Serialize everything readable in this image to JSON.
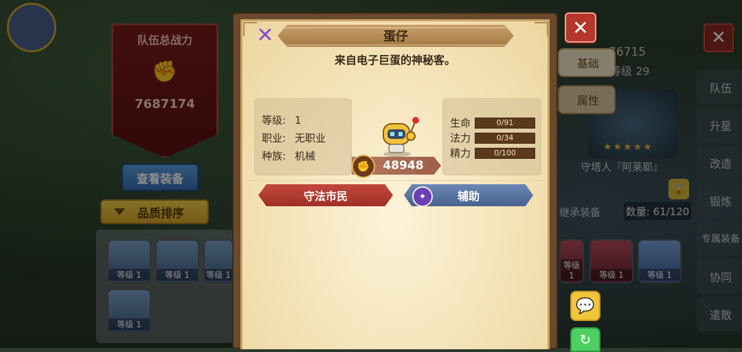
{
  "background": {
    "team_power_title": "队伍总战力",
    "team_power_value": "7687174",
    "view_equipment_button": "查看装备",
    "quality_sort_button": "品质排序",
    "hero_level_labels": [
      "等级 1",
      "等级 1",
      "等级 1",
      "等级 1"
    ],
    "right_hero_level_labels": [
      "等级 1",
      "等级 1",
      "等级 1"
    ],
    "right_top_number": "76715",
    "right_top_level": "等级 29",
    "tab_basic": "基础",
    "tab_attributes": "属性",
    "hero_subname": "守塔人『阿莱耶』",
    "inherit_equipment": "继承装备",
    "count": "数量: 61/120",
    "side_menu": [
      "队伍",
      "升星",
      "改造",
      "锻炼",
      "专属装备",
      "协同",
      "遣散"
    ]
  },
  "modal": {
    "title": "蛋仔",
    "description": "来自电子巨蛋的神秘客。",
    "info": [
      {
        "key": "等级:",
        "value": "1"
      },
      {
        "key": "职业:",
        "value": "无职业"
      },
      {
        "key": "种族:",
        "value": "机械"
      }
    ],
    "stats": [
      {
        "key": "生命",
        "value": "0/91"
      },
      {
        "key": "法力",
        "value": "0/34"
      },
      {
        "key": "精力",
        "value": "0/100"
      }
    ],
    "power": "48948",
    "faction_tag": "守法市民",
    "role_tag": "辅助"
  },
  "colors": {
    "modal_frame": "#6a4a2c",
    "parchment": "#f4e3b8",
    "faction_red": "#b33c32",
    "role_blue": "#5a76a6",
    "close_red": "#b5362b",
    "close_x_purple": "#7e4fd0"
  }
}
